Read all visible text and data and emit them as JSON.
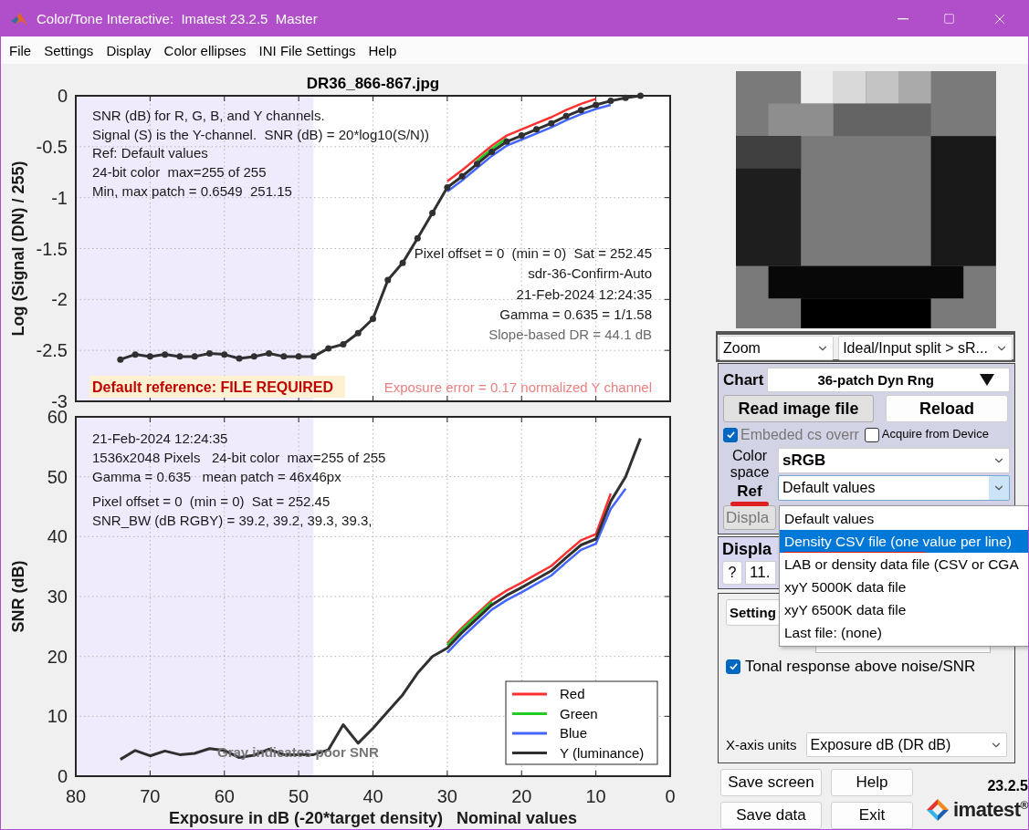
{
  "window": {
    "title": "Color/Tone Interactive:  Imatest 23.2.5  Master"
  },
  "menu": [
    "File",
    "Settings",
    "Display",
    "Color ellipses",
    "INI File Settings",
    "Help"
  ],
  "plots": {
    "tonal": {
      "info_lines": [
        "SNR (dB) for R, G, B, and Y channels.",
        "Signal (S) is the Y-channel.  SNR (dB) = 20*log10(S/N))",
        "Ref: Default values",
        "24-bit color  max=255 of 255",
        "Min, max patch = 0.6549  251.15"
      ],
      "right_lines": [
        {
          "text": "Pixel offset = 0  (min = 0)  Sat = 252.45",
          "muted": false
        },
        {
          "text": "sdr-36-Confirm-Auto",
          "muted": false
        },
        {
          "text": "21-Feb-2024 12:24:35",
          "muted": false
        },
        {
          "text": "Gamma = 0.635 = 1/1.58",
          "muted": false
        },
        {
          "text": "Slope-based DR = 44.1 dB",
          "muted": true
        }
      ],
      "reference_warning": "Default reference: FILE REQUIRED",
      "exposure_error": "Exposure error = 0.17 normalized Y channel",
      "chart_data": {
        "type": "line",
        "title": "DR36_866-867.jpg",
        "ylabel": "Log (Signal (DN) / 255)",
        "grid": true,
        "x": [
          74,
          72,
          70,
          68,
          66,
          64,
          62,
          60,
          58,
          56,
          54,
          52,
          50,
          48,
          46,
          44,
          42,
          40,
          38,
          36,
          34,
          32,
          30,
          28,
          26,
          24,
          22,
          20,
          18,
          16,
          14,
          12,
          10,
          8,
          6,
          4
        ],
        "series": [
          {
            "color": "#ff3030",
            "values": [
              null,
              null,
              null,
              null,
              null,
              null,
              null,
              null,
              null,
              null,
              null,
              null,
              null,
              null,
              null,
              null,
              null,
              null,
              null,
              null,
              null,
              null,
              -0.84,
              -0.73,
              -0.61,
              -0.49,
              -0.39,
              -0.33,
              -0.27,
              -0.21,
              -0.14,
              -0.08,
              -0.03,
              null,
              null,
              null
            ]
          },
          {
            "color": "#22cc22",
            "values": [
              null,
              null,
              null,
              null,
              null,
              null,
              null,
              null,
              null,
              null,
              null,
              null,
              null,
              null,
              null,
              null,
              null,
              null,
              null,
              null,
              null,
              null,
              null,
              null,
              -0.64,
              -0.52,
              -0.42,
              null,
              null,
              null,
              null,
              null,
              null,
              null,
              null,
              null
            ]
          },
          {
            "color": "#4466ff",
            "values": [
              null,
              null,
              null,
              null,
              null,
              null,
              null,
              null,
              null,
              null,
              null,
              null,
              null,
              null,
              null,
              null,
              null,
              null,
              null,
              null,
              null,
              null,
              -0.94,
              -0.83,
              -0.71,
              -0.59,
              -0.49,
              -0.43,
              -0.37,
              -0.31,
              -0.24,
              -0.18,
              -0.13,
              -0.09,
              null,
              null
            ]
          },
          {
            "color": "#303030",
            "marker": true,
            "values": [
              -2.59,
              -2.54,
              -2.56,
              -2.54,
              -2.56,
              -2.56,
              -2.53,
              -2.54,
              -2.58,
              -2.56,
              -2.53,
              -2.56,
              -2.56,
              -2.56,
              -2.48,
              -2.44,
              -2.33,
              -2.19,
              -1.81,
              -1.64,
              -1.4,
              -1.15,
              -0.9,
              -0.79,
              -0.67,
              -0.55,
              -0.45,
              -0.39,
              -0.33,
              -0.27,
              -0.2,
              -0.14,
              -0.09,
              -0.05,
              -0.02,
              0
            ]
          }
        ],
        "xlim": [
          80,
          0
        ],
        "ylim": [
          -3,
          0
        ],
        "yticks": [
          0,
          -0.5,
          -1,
          -1.5,
          -2,
          -2.5,
          -3
        ]
      }
    },
    "snr": {
      "info_blocks": [
        [
          "21-Feb-2024 12:24:35",
          "1536x2048 Pixels   24-bit color  max=255 of 255",
          "Gamma = 0.635   mean patch = 46x46px"
        ],
        [
          "Pixel offset = 0  (min = 0)  Sat = 252.45",
          "SNR_BW (dB RGBY) = 39.2, 39.2, 39.3, 39.3,"
        ]
      ],
      "note": "Gray indicates poor SNR",
      "chart_data": {
        "type": "line",
        "xlabel": "Exposure in dB (-20*target density)   Nominal values",
        "ylabel": "SNR (dB)",
        "grid": true,
        "legend": true,
        "x": [
          74,
          72,
          70,
          68,
          66,
          64,
          62,
          60,
          58,
          56,
          54,
          52,
          50,
          48,
          46,
          44,
          42,
          40,
          38,
          36,
          34,
          32,
          30,
          28,
          26,
          24,
          22,
          20,
          18,
          16,
          14,
          12,
          10,
          8,
          6,
          4
        ],
        "series": [
          {
            "name": "Red",
            "color": "#ff3030",
            "values": [
              null,
              null,
              null,
              null,
              null,
              null,
              null,
              null,
              null,
              null,
              null,
              null,
              null,
              null,
              null,
              null,
              null,
              null,
              null,
              null,
              null,
              null,
              22.2,
              24.8,
              27.1,
              29.4,
              31,
              32.3,
              33.7,
              35.1,
              37.3,
              39.4,
              40.4,
              47.2,
              null,
              null
            ]
          },
          {
            "name": "Green",
            "color": "#22cc22",
            "values": [
              null,
              null,
              null,
              null,
              null,
              null,
              null,
              null,
              null,
              null,
              null,
              null,
              null,
              null,
              null,
              null,
              null,
              null,
              null,
              null,
              null,
              null,
              21.9,
              24.5,
              26.8,
              29.1,
              null,
              null,
              null,
              null,
              null,
              null,
              null,
              null,
              null,
              null
            ]
          },
          {
            "name": "Blue",
            "color": "#4466ff",
            "values": [
              null,
              null,
              null,
              null,
              null,
              null,
              null,
              null,
              null,
              null,
              null,
              null,
              null,
              null,
              null,
              null,
              null,
              null,
              null,
              null,
              null,
              null,
              20.6,
              23.2,
              25.5,
              27.8,
              29.4,
              30.7,
              32.1,
              33.5,
              35.7,
              37.8,
              38.8,
              44.6,
              48,
              null
            ]
          },
          {
            "name": "Y (luminance)",
            "color": "#303030",
            "values": [
              2.8,
              4.3,
              3.4,
              4.2,
              3.6,
              3.8,
              4.6,
              4.3,
              3.1,
              3.5,
              4.5,
              3.6,
              3.6,
              3.6,
              4.4,
              8.6,
              5.5,
              8,
              10.8,
              13.6,
              17.2,
              20,
              21.4,
              24,
              26.3,
              28.6,
              30.2,
              31.5,
              32.9,
              34.3,
              36.5,
              38.6,
              39.6,
              45.9,
              50,
              56.4
            ]
          }
        ],
        "xlim": [
          80,
          0
        ],
        "ylim": [
          0,
          60
        ],
        "xticks": [
          80,
          70,
          60,
          50,
          40,
          30,
          20,
          10,
          0
        ],
        "yticks": [
          0,
          10,
          20,
          30,
          40,
          50,
          60
        ]
      }
    }
  },
  "side_panel": {
    "thumbnail": {
      "kind": "picture"
    },
    "view_selects": [
      "Zoom",
      "Ideal/Input split > sR..."
    ],
    "chart": {
      "label": "Chart",
      "value": "36-patch Dyn Rng"
    },
    "file_buttons": [
      "Read image file",
      "Reload"
    ],
    "checks": [
      {
        "label": "Embeded cs overr",
        "checked": true,
        "disabled": true
      },
      {
        "label": "Acquire from Device",
        "checked": false,
        "disabled": false
      }
    ],
    "color_space": {
      "label": "Color space",
      "value": "sRGB"
    },
    "ref": {
      "label": "Ref",
      "value": "Default values",
      "expanded": true
    },
    "display_button": "Displa",
    "display_section": {
      "title": "Displa",
      "help": "?",
      "value": "11."
    },
    "settings_button": "Setting",
    "tonal_check": {
      "label": "Tonal response above noise/SNR",
      "checked": true
    },
    "x_axis": {
      "label": "X-axis units",
      "value": "Exposure dB (DR dB)"
    },
    "buttons": [
      "Save screen",
      "Help",
      "Save data",
      "Exit"
    ],
    "version": "23.2.5",
    "brand": "imatest$^{®}$"
  },
  "ref_menu": [
    {
      "label": "Default values",
      "selected": false
    },
    {
      "label": "Density CSV file (one value per line)",
      "selected": true
    },
    {
      "label": "LAB or density data file (CSV or CGA",
      "selected": false
    },
    {
      "label": "xyY 5000K data file",
      "selected": false
    },
    {
      "label": "xyY 6500K data file",
      "selected": false
    },
    {
      "label": "Last file: (none)",
      "selected": false
    }
  ]
}
